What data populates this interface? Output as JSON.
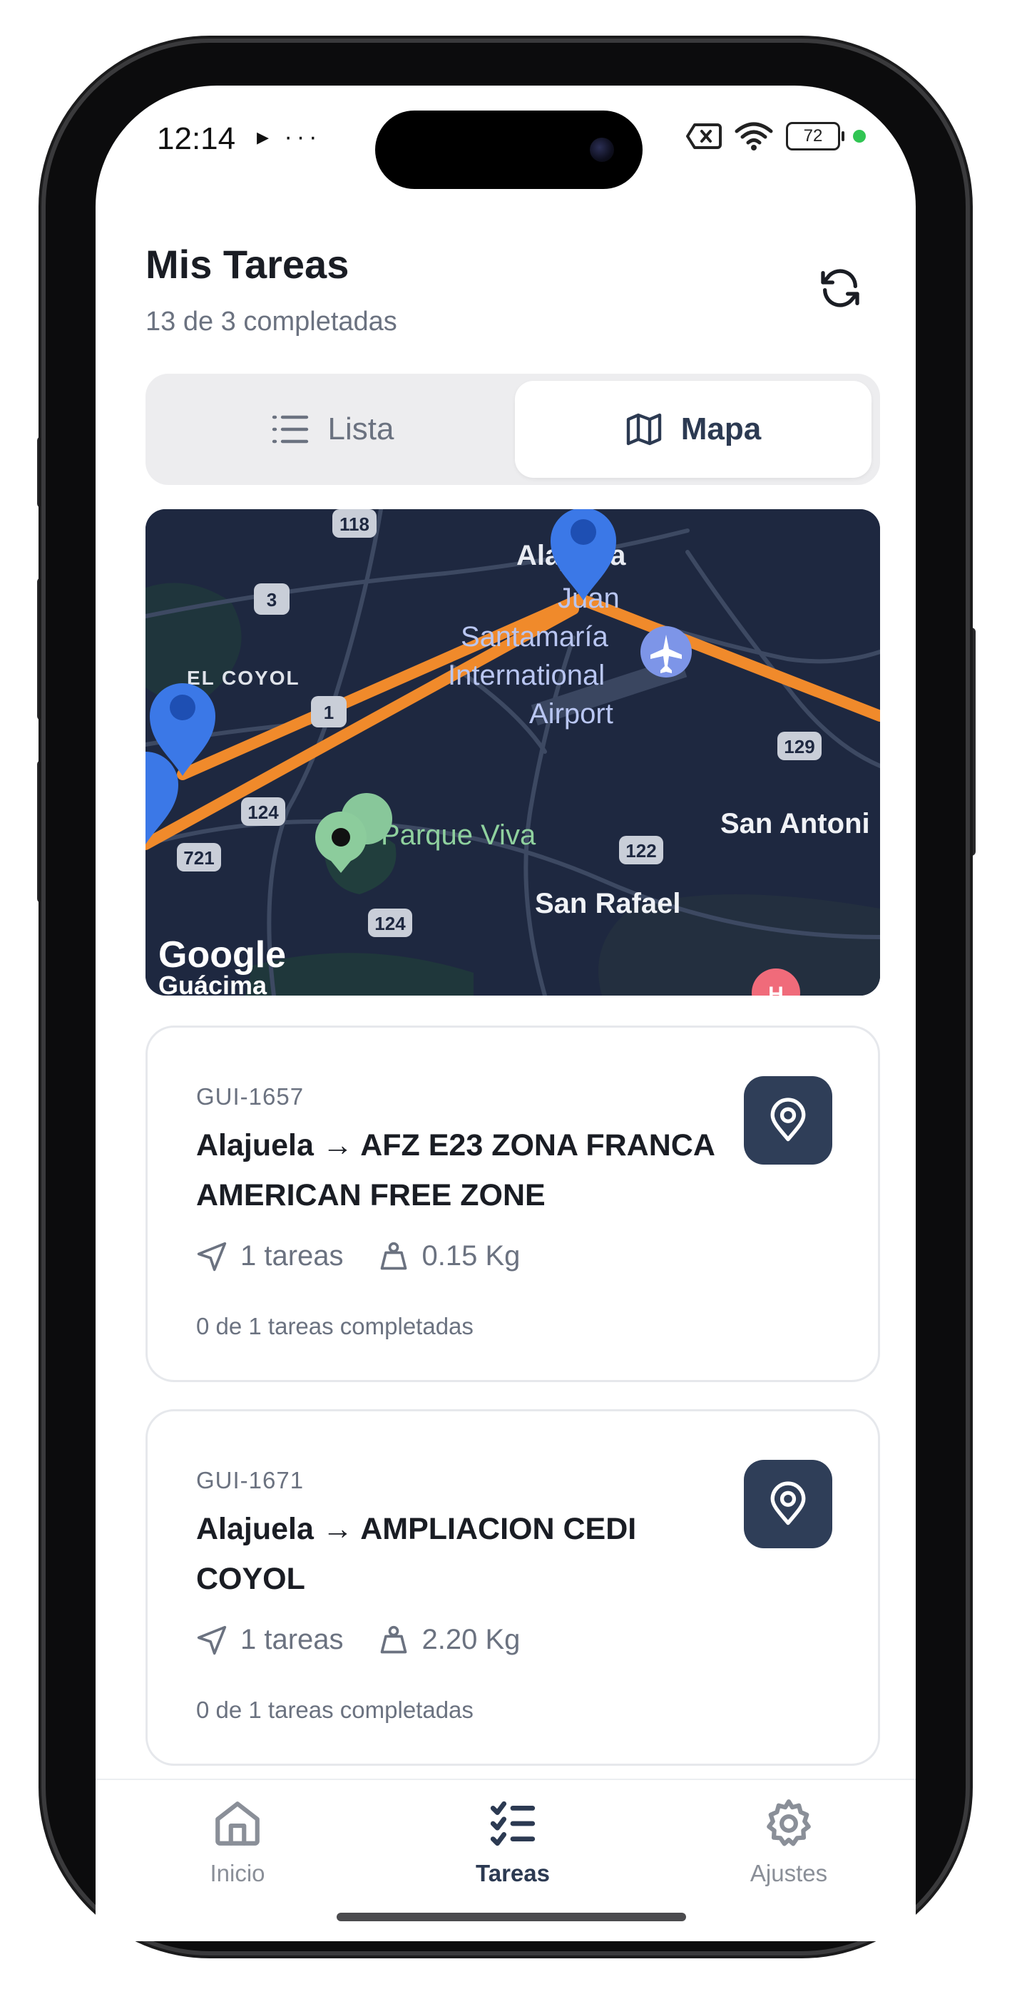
{
  "status_bar": {
    "time": "12:14",
    "left_icons": "▸ ···",
    "battery": "72",
    "indicator_color": "#31c553"
  },
  "header": {
    "title": "Mis Tareas",
    "subtitle": "13 de 3 completadas",
    "refresh_icon": "refresh-icon"
  },
  "view_toggle": {
    "list_label": "Lista",
    "map_label": "Mapa",
    "selected": "Mapa"
  },
  "map": {
    "labels": {
      "city_top": "Alajuela",
      "airport_line1": "Juan",
      "airport_line2": "Santamaría",
      "airport_line3": "International",
      "airport_line4": "Airport",
      "el_coyol": "EL COYOL",
      "parque_viva": "Parque Viva",
      "san_antonio": "San Antoni",
      "san_rafael": "San Rafael",
      "guacima": "Guácima",
      "attribution": "Google"
    },
    "route_shields": [
      "118",
      "3",
      "1",
      "124",
      "721",
      "124",
      "122",
      "129"
    ],
    "route_color": "#f08a2b",
    "marker_color": "#3b78e7"
  },
  "tasks": [
    {
      "code": "GUI-1657",
      "title": "Alajuela → AFZ E23 ZONA FRANCA AMERICAN FREE ZONE",
      "tasks_count": "1 tareas",
      "weight": "0.15 Kg",
      "progress": "0 de 1 tareas completadas"
    },
    {
      "code": "GUI-1671",
      "title": "Alajuela → AMPLIACION CEDI COYOL",
      "tasks_count": "1 tareas",
      "weight": "2.20 Kg",
      "progress": "0 de 1 tareas completadas"
    }
  ],
  "bottom_nav": {
    "items": [
      {
        "label": "Inicio",
        "icon": "home-icon"
      },
      {
        "label": "Tareas",
        "icon": "checklist-icon",
        "active": true
      },
      {
        "label": "Ajustes",
        "icon": "gear-icon"
      }
    ]
  },
  "colors": {
    "accent": "#2f3e58",
    "map_background": "#1e2840",
    "muted_text": "#6b7280"
  }
}
